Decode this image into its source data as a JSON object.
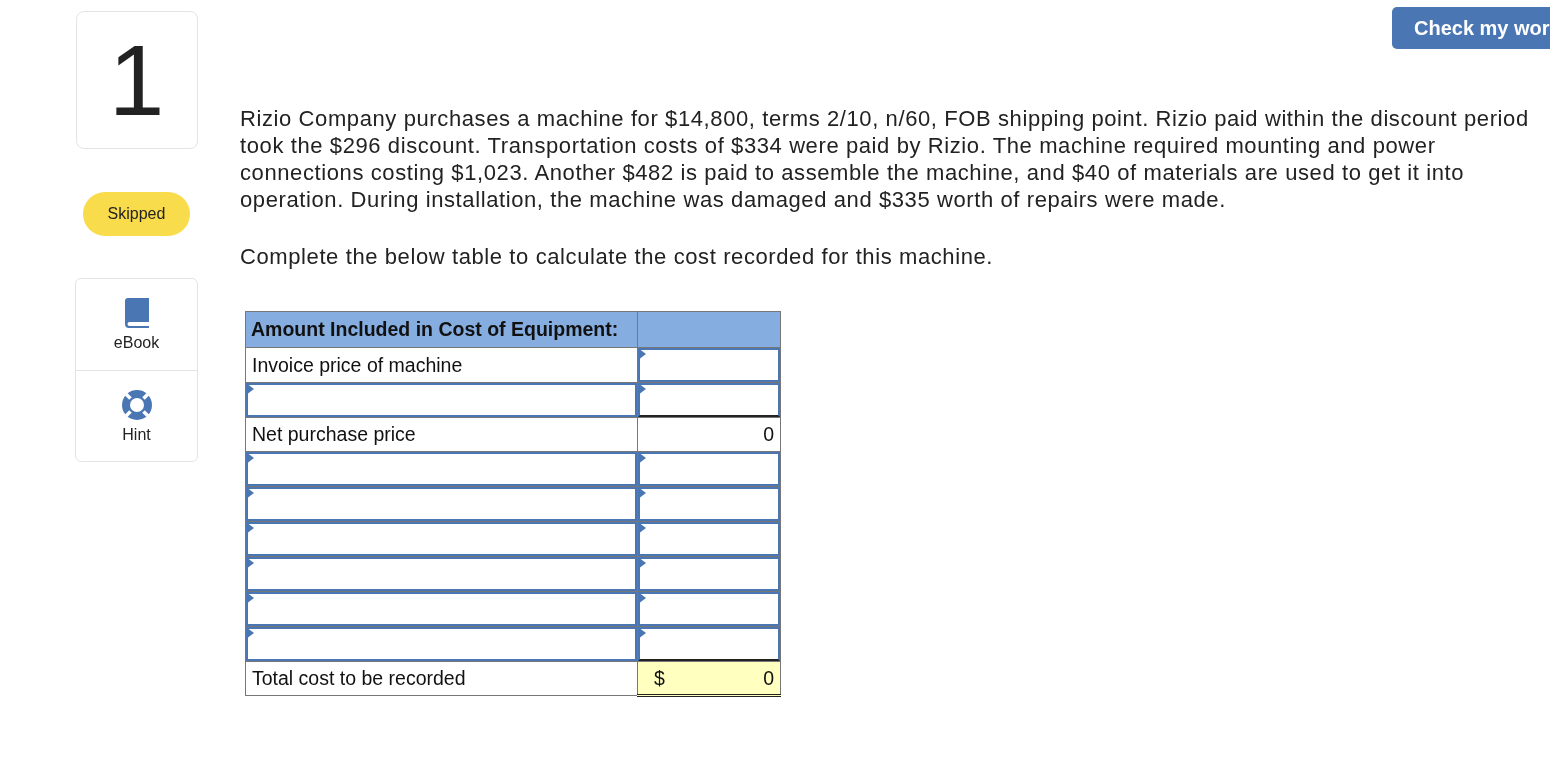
{
  "question": {
    "number": "1",
    "status": "Skipped"
  },
  "tools": [
    {
      "kind": "ebook",
      "label": "eBook"
    },
    {
      "kind": "hint",
      "label": "Hint"
    }
  ],
  "check_button": {
    "label": "Check my wor"
  },
  "problem": {
    "lines": [
      "Rizio Company purchases a machine for $14,800, terms 2/10, n/60, FOB shipping point. Rizio paid within the discount period",
      "took the $296 discount. Transportation costs of $334 were paid by Rizio. The machine required mounting and power",
      "connections costing $1,023. Another $482 is paid to assemble the machine, and $40 of materials are used to get it into",
      "operation. During installation, the machine was damaged and $335 worth of repairs were made."
    ],
    "instruction": "Complete the below table to calculate the cost recorded for this machine."
  },
  "table": {
    "header": "Amount Included in Cost of Equipment:",
    "rows": [
      {
        "kind": "given",
        "label": "Invoice price of machine"
      },
      {
        "kind": "entry"
      },
      {
        "kind": "computed",
        "label": "Net purchase price",
        "value": "0"
      },
      {
        "kind": "entry"
      },
      {
        "kind": "entry"
      },
      {
        "kind": "entry"
      },
      {
        "kind": "entry"
      },
      {
        "kind": "entry"
      },
      {
        "kind": "entry"
      },
      {
        "kind": "total",
        "label": "Total cost to be recorded",
        "currency": "$",
        "value": "0"
      }
    ]
  }
}
